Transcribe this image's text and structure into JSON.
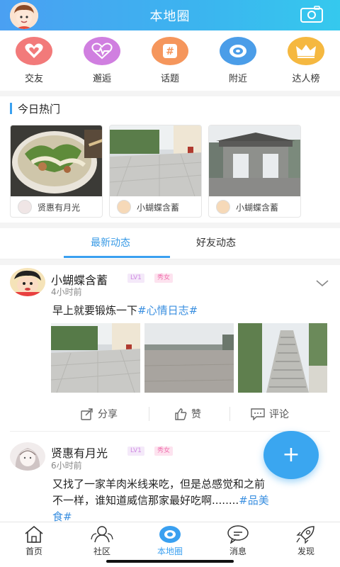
{
  "header": {
    "title": "本地圈",
    "left_icon": "user-avatar",
    "right_icon": "camera-icon"
  },
  "categories": [
    {
      "label": "交友",
      "icon": "heart-icon",
      "color": "#f27a7a"
    },
    {
      "label": "邂逅",
      "icon": "heartbeat-icon",
      "color": "#d07fe0"
    },
    {
      "label": "话题",
      "icon": "hashtag-icon",
      "color": "#f5965c"
    },
    {
      "label": "附近",
      "icon": "location-icon",
      "color": "#4b9de8"
    },
    {
      "label": "达人榜",
      "icon": "crown-icon",
      "color": "#f5b840"
    }
  ],
  "hot": {
    "title": "今日热门",
    "cards": [
      {
        "user": "贤惠有月光",
        "image": "noodle-bowl-photo"
      },
      {
        "user": "小蝴蝶含蓄",
        "image": "plaza-photo"
      },
      {
        "user": "小蝴蝶含蓄",
        "image": "archway-gate-photo"
      }
    ]
  },
  "tabs": {
    "active": "最新动态",
    "inactive": "好友动态"
  },
  "posts": [
    {
      "name": "小蝴蝶含蓄",
      "level": "LV1",
      "gender_badge": "秀女",
      "time": "4小时前",
      "text": "早上就要锻炼一下",
      "tag": "#心情日志#",
      "images": [
        "plaza-photo",
        "square-photo",
        "stairs-photo"
      ],
      "actions": {
        "share": "分享",
        "like": "赞",
        "comment": "评论"
      }
    },
    {
      "name": "贤惠有月光",
      "level": "LV1",
      "gender_badge": "秀女",
      "time": "6小时前",
      "text_line1": "又找了一家羊肉米线来吃，但是总感觉和之前",
      "text_line2": "不一样，谁知道威信那家最好吃啊........",
      "tag_line2": "#品美",
      "text_line3": "食#"
    }
  ],
  "fab": {
    "label": "+"
  },
  "bottom_nav": [
    {
      "label": "首页",
      "icon": "home-icon",
      "active": false
    },
    {
      "label": "社区",
      "icon": "community-icon",
      "active": false
    },
    {
      "label": "本地圈",
      "icon": "local-circle-icon",
      "active": true
    },
    {
      "label": "消息",
      "icon": "message-icon",
      "active": false
    },
    {
      "label": "发现",
      "icon": "rocket-icon",
      "active": false
    }
  ],
  "colors": {
    "accent": "#3aa0f0",
    "tag": "#3a8fe0",
    "badge_lv": "#d08be2",
    "badge_sex": "#f074b0"
  }
}
